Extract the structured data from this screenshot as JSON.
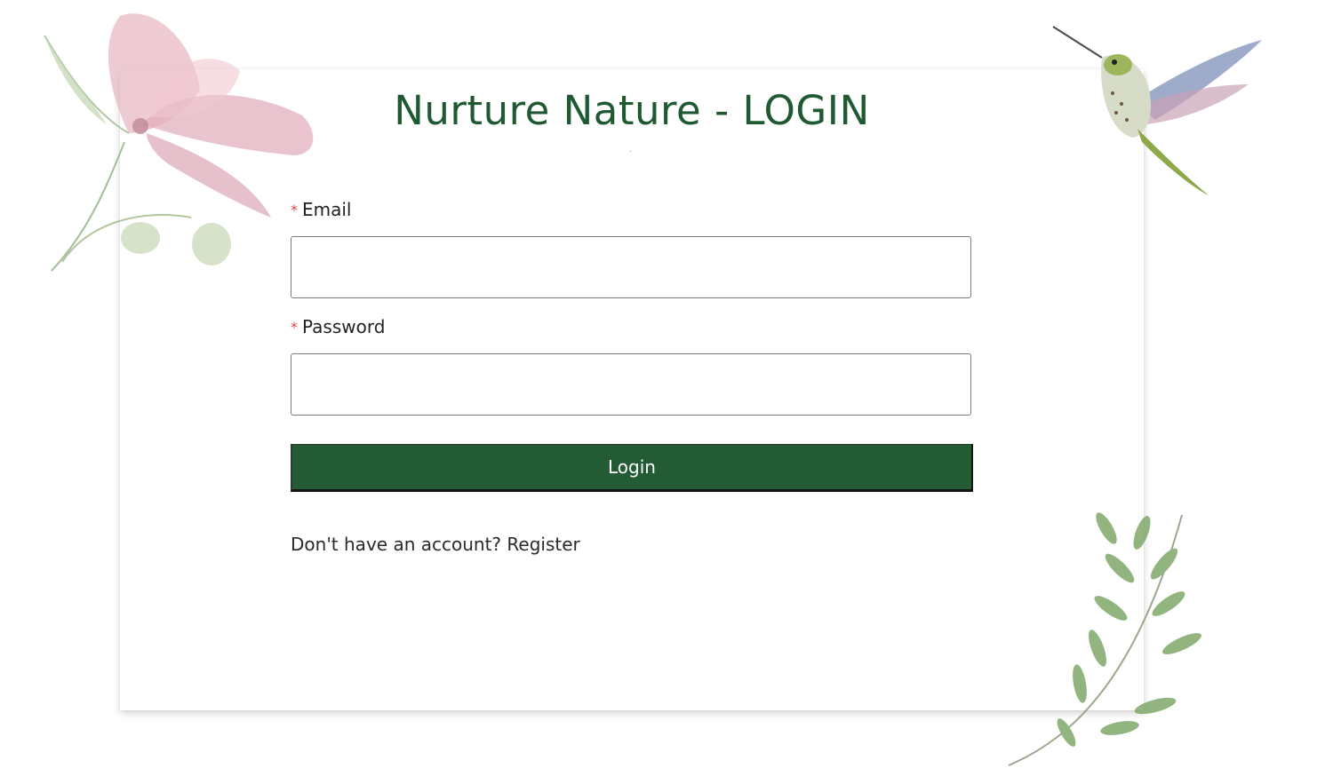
{
  "form": {
    "title": "Nurture Nature - LOGIN",
    "email": {
      "required_mark": "*",
      "label": "Email",
      "value": "",
      "placeholder": ""
    },
    "password": {
      "required_mark": "*",
      "label": "Password",
      "value": "",
      "placeholder": ""
    },
    "submit_label": "Login",
    "register_prompt": "Don't have an account?",
    "register_link": "Register"
  },
  "colors": {
    "brand_green": "#1f5932",
    "button_green": "#235b35",
    "required_red": "#e04848",
    "flower_pink": "#c98a9a",
    "leaf_green": "#6f9a5c"
  },
  "decorations": {
    "top_left": "watercolor-flower",
    "top_right": "hummingbird",
    "bottom_right": "leafy-branch"
  }
}
